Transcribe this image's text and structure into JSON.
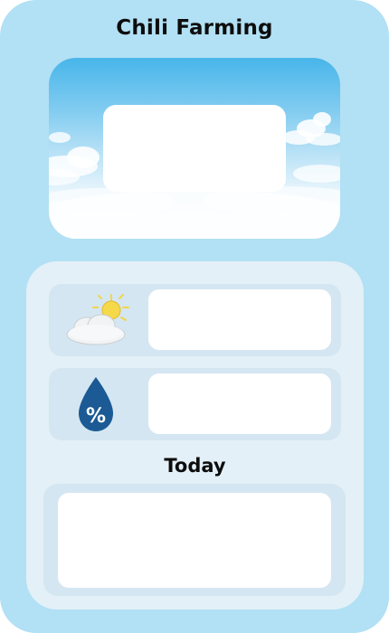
{
  "header": {
    "title": "Chili Farming"
  },
  "sky_card": {
    "icon": "sky-clouds-image"
  },
  "weather_row": {
    "icon": "partly-cloudy-icon"
  },
  "humidity_row": {
    "icon": "humidity-drop-icon",
    "icon_glyph": "%"
  },
  "today": {
    "title": "Today"
  },
  "colors": {
    "background": "#b2e0f4",
    "panel": "#e3f0f7",
    "row": "#d4e6f1",
    "drop": "#1b5a94"
  }
}
